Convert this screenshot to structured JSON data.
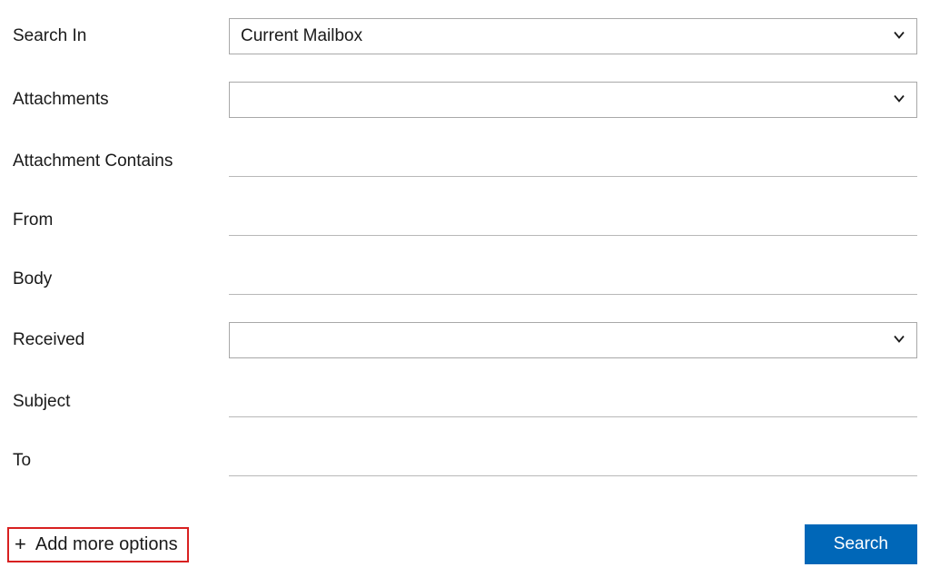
{
  "form": {
    "search_in": {
      "label": "Search In",
      "value": "Current Mailbox"
    },
    "attachments": {
      "label": "Attachments",
      "value": ""
    },
    "attachment_contains": {
      "label": "Attachment Contains",
      "value": ""
    },
    "from": {
      "label": "From",
      "value": ""
    },
    "body": {
      "label": "Body",
      "value": ""
    },
    "received": {
      "label": "Received",
      "value": ""
    },
    "subject": {
      "label": "Subject",
      "value": ""
    },
    "to": {
      "label": "To",
      "value": ""
    }
  },
  "actions": {
    "add_more_options": "Add more options",
    "search": "Search"
  },
  "colors": {
    "primary": "#0067b8",
    "highlight_border": "#d82020"
  }
}
